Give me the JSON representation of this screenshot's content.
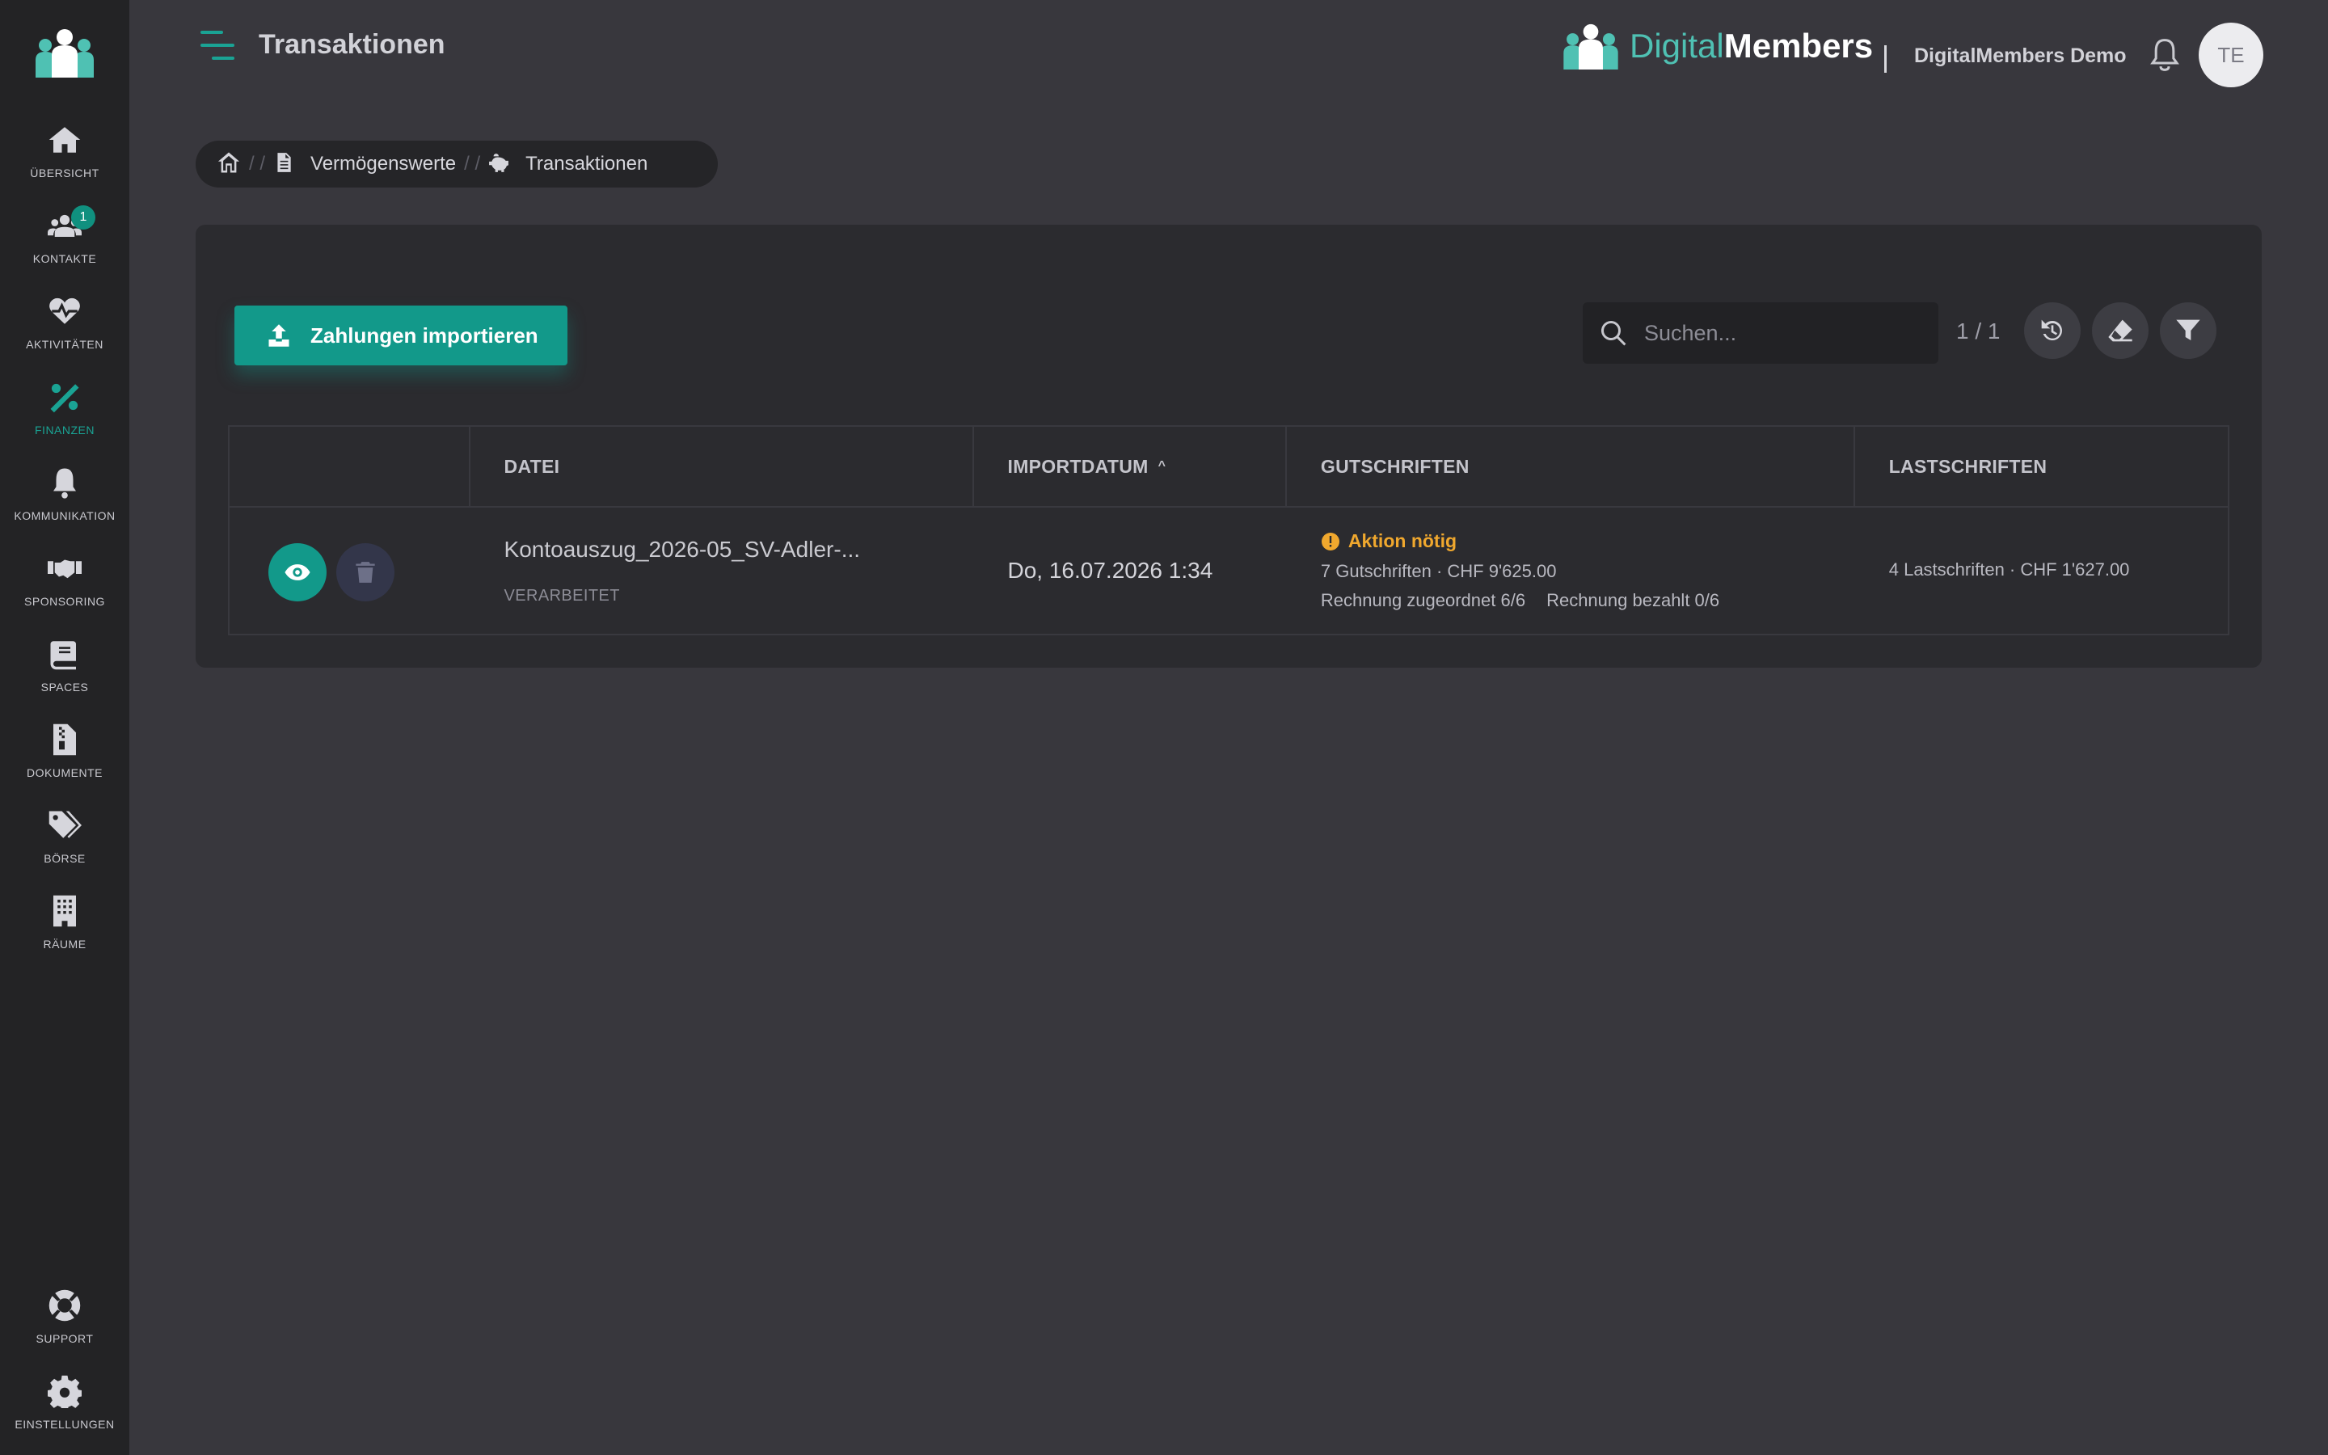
{
  "sidebar": {
    "items": [
      {
        "label": "ÜBERSICHT",
        "icon": "home-icon"
      },
      {
        "label": "KONTAKTE",
        "icon": "users-icon",
        "badge": "1"
      },
      {
        "label": "AKTIVITÄTEN",
        "icon": "heartbeat-icon"
      },
      {
        "label": "FINANZEN",
        "icon": "percent-icon",
        "active": true
      },
      {
        "label": "KOMMUNIKATION",
        "icon": "bell-icon"
      },
      {
        "label": "SPONSORING",
        "icon": "handshake-icon"
      },
      {
        "label": "SPACES",
        "icon": "book-icon"
      },
      {
        "label": "DOKUMENTE",
        "icon": "file-zipper-icon"
      },
      {
        "label": "BÖRSE",
        "icon": "tags-icon"
      },
      {
        "label": "RÄUME",
        "icon": "building-icon"
      }
    ],
    "bottom": [
      {
        "label": "SUPPORT",
        "icon": "lifebuoy-icon"
      },
      {
        "label": "EINSTELLUNGEN",
        "icon": "gear-icon"
      }
    ]
  },
  "header": {
    "title": "Transaktionen",
    "brand_light": "Digital",
    "brand_bold": "Members",
    "org_name": "DigitalMembers Demo",
    "avatar_initials": "TE"
  },
  "breadcrumb": {
    "items": [
      "Vermögenswerte",
      "Transaktionen"
    ]
  },
  "toolbar": {
    "import_label": "Zahlungen importieren",
    "search_placeholder": "Suchen...",
    "pager": "1 / 1"
  },
  "table": {
    "headers": [
      "DATEI",
      "IMPORTDATUM",
      "GUTSCHRIFTEN",
      "LASTSCHRIFTEN"
    ],
    "sort_indicator": "^",
    "rows": [
      {
        "file_name": "Kontoauszug_2026-05_SV-Adler-...",
        "status": "VERARBEITET",
        "import_date": "Do, 16.07.2026 1:34",
        "action": "Aktion nötig",
        "credits": "7 Gutschriften · CHF 9'625.00",
        "invoice_assigned": "Rechnung zugeordnet 6/6",
        "invoice_paid": "Rechnung bezahlt 0/6",
        "debits": "4 Lastschriften · CHF 1'627.00"
      }
    ]
  },
  "colors": {
    "accent": "#12998a",
    "warning": "#f0a82e",
    "sidebar_bg": "#232325",
    "page_bg": "#38373d"
  }
}
